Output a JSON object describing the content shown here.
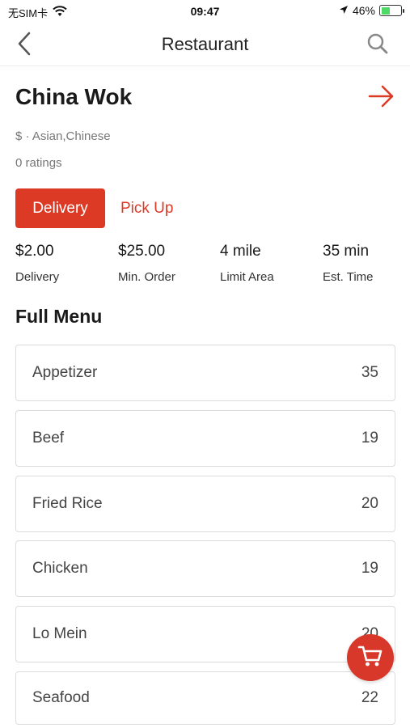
{
  "status_bar": {
    "carrier": "无SIM卡",
    "time": "09:47",
    "battery": "46%",
    "battery_level": 0.46
  },
  "nav": {
    "title": "Restaurant",
    "back_icon": "chevron-left-icon",
    "search_icon": "search-icon"
  },
  "restaurant": {
    "name": "China Wok",
    "price_cuisine": "$ · Asian,Chinese",
    "ratings": "0 ratings"
  },
  "modes": {
    "delivery": "Delivery",
    "pickup": "Pick Up",
    "selected": "Delivery"
  },
  "stats": [
    {
      "value": "$2.00",
      "label": "Delivery"
    },
    {
      "value": "$25.00",
      "label": "Min. Order"
    },
    {
      "value": "4 mile",
      "label": "Limit Area"
    },
    {
      "value": "35 min",
      "label": "Est. Time"
    }
  ],
  "menu": {
    "title": "Full Menu",
    "categories": [
      {
        "name": "Appetizer",
        "count": "35"
      },
      {
        "name": "Beef",
        "count": "19"
      },
      {
        "name": "Fried Rice",
        "count": "20"
      },
      {
        "name": "Chicken",
        "count": "19"
      },
      {
        "name": "Lo Mein",
        "count": "20"
      },
      {
        "name": "Seafood",
        "count": "22"
      }
    ]
  },
  "colors": {
    "accent": "#dd3a26",
    "battery": "#4cd964"
  }
}
